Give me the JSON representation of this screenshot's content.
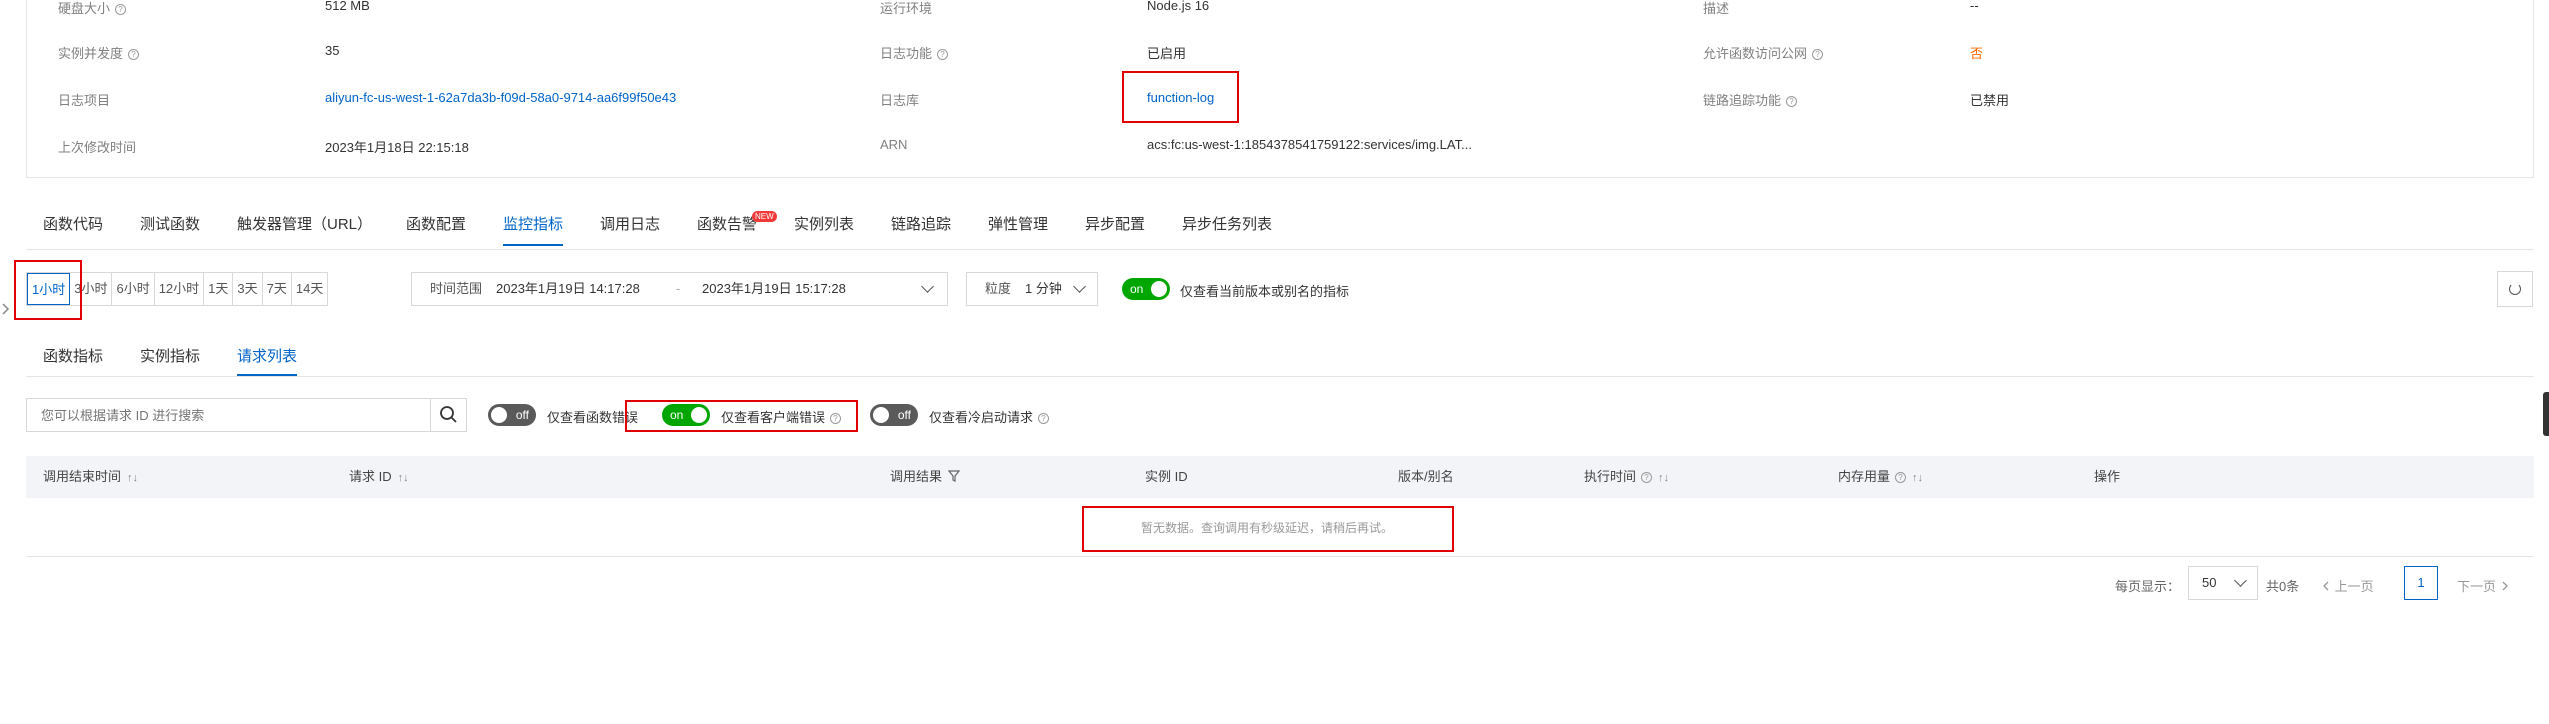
{
  "info": {
    "row0": {
      "k1": "硬盘大小",
      "v1": "512 MB",
      "k2": "运行环境",
      "v2": "Node.js 16",
      "k3": "描述",
      "v3": "--"
    },
    "row1": {
      "k1": "实例并发度",
      "v1": "35",
      "k2": "日志功能",
      "v2": "已启用",
      "k3": "允许函数访问公网",
      "v3": "否"
    },
    "row2": {
      "k1": "日志项目",
      "v1": "aliyun-fc-us-west-1-62a7da3b-f09d-58a0-9714-aa6f99f50e43",
      "k2": "日志库",
      "v2": "function-log",
      "k3": "链路追踪功能",
      "v3": "已禁用"
    },
    "row3": {
      "k1": "上次修改时间",
      "v1": "2023年1月18日 22:15:18",
      "k2": "ARN",
      "v2": "acs:fc:us-west-1:1854378541759122:services/img.LAT..."
    }
  },
  "tabs": [
    "函数代码",
    "测试函数",
    "触发器管理（URL）",
    "函数配置",
    "监控指标",
    "调用日志",
    "函数告警",
    "实例列表",
    "链路追踪",
    "弹性管理",
    "异步配置",
    "异步任务列表"
  ],
  "tab_badge": "NEW",
  "time_ranges": [
    "1小时",
    "3小时",
    "6小时",
    "12小时",
    "1天",
    "3天",
    "7天",
    "14天"
  ],
  "time_range": {
    "label": "时间范围",
    "start": "2023年1月19日 14:17:28",
    "sep": "-",
    "end": "2023年1月19日 15:17:28"
  },
  "granularity": {
    "label": "粒度",
    "value": "1 分钟"
  },
  "version_toggle": {
    "state": "on",
    "label": "仅查看当前版本或别名的指标"
  },
  "subtabs": [
    "函数指标",
    "实例指标",
    "请求列表"
  ],
  "search": {
    "placeholder": "您可以根据请求 ID 进行搜索"
  },
  "filters": {
    "func_error": {
      "state": "off",
      "label": "仅查看函数错误"
    },
    "client_error": {
      "state": "on",
      "label": "仅查看客户端错误"
    },
    "cold_start": {
      "state": "off",
      "label": "仅查看冷启动请求"
    }
  },
  "columns": [
    "调用结束时间",
    "请求 ID",
    "调用结果",
    "实例 ID",
    "版本/别名",
    "执行时间",
    "内存用量",
    "操作"
  ],
  "empty_message": "暂无数据。查询调用有秒级延迟，请稍后再试。",
  "pagination": {
    "per_page_label": "每页显示：",
    "per_page": "50",
    "total": "共0条",
    "prev": "上一页",
    "page": "1",
    "next": "下一页"
  }
}
